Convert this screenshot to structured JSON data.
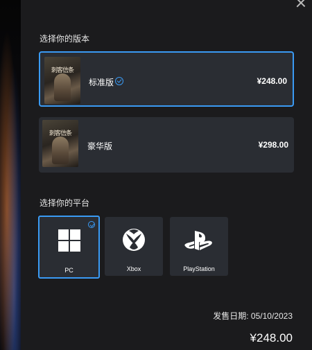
{
  "editions_title": "选择你的版本",
  "editions": [
    {
      "name": "标准版",
      "price": "¥248.00",
      "selected": true,
      "cover_text": "刺客信条"
    },
    {
      "name": "豪华版",
      "price": "¥298.00",
      "selected": false,
      "cover_text": "刺客信条"
    }
  ],
  "platforms_title": "选择你的平台",
  "platforms": [
    {
      "label": "PC",
      "icon": "windows-icon",
      "selected": true
    },
    {
      "label": "Xbox",
      "icon": "xbox-icon",
      "selected": false
    },
    {
      "label": "PlayStation",
      "icon": "playstation-icon",
      "selected": false
    }
  ],
  "release_date": "发售日期: 05/10/2023",
  "total_price": "¥248.00",
  "colors": {
    "accent": "#3a9bf5",
    "panel": "#1b1b1d",
    "card": "#2a2d33"
  }
}
